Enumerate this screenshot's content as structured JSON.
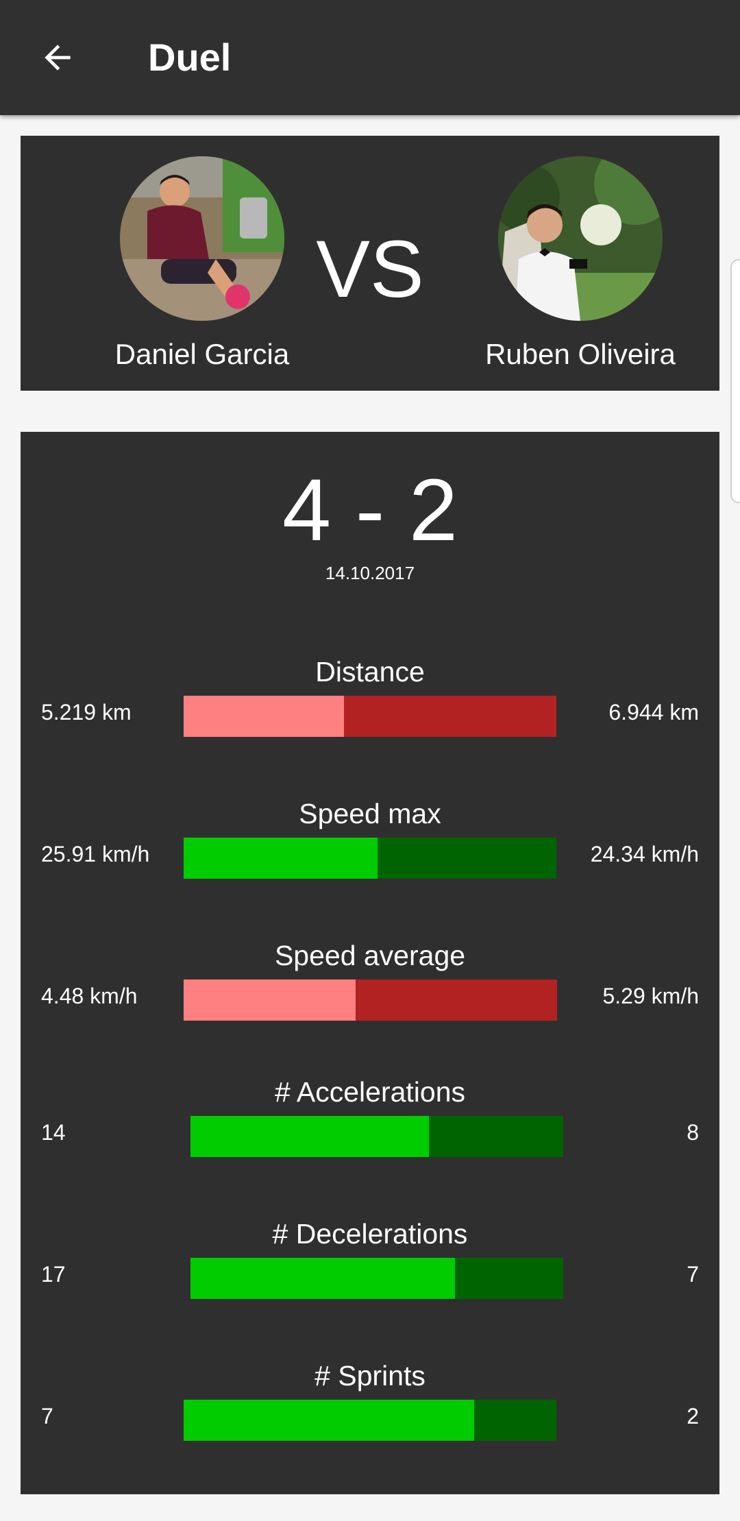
{
  "header": {
    "title": "Duel",
    "back_icon": "arrow-back-icon"
  },
  "duel": {
    "player_left": {
      "name": "Daniel Garcia"
    },
    "player_right": {
      "name": "Ruben Oliveira"
    },
    "vs_label": "VS",
    "score": "4 - 2",
    "date": "14.10.2017"
  },
  "colors": {
    "appbar": "#303030",
    "card": "#302f2f",
    "win_light": "#00cc00",
    "win_dark": "#006400",
    "lose_light": "#ff8080",
    "lose_dark": "#b22222"
  },
  "stats": [
    {
      "label": "Distance",
      "left_value": "5.219 km",
      "right_value": "6.944 km",
      "left_share": 0.43,
      "scheme": "lose"
    },
    {
      "label": "Speed max",
      "left_value": "25.91 km/h",
      "right_value": "24.34 km/h",
      "left_share": 0.52,
      "scheme": "win"
    },
    {
      "label": "Speed average",
      "left_value": "4.48 km/h",
      "right_value": "5.29 km/h",
      "left_share": 0.46,
      "scheme": "lose"
    },
    {
      "label": "# Accelerations",
      "left_value": "14",
      "right_value": "8",
      "left_share": 0.64,
      "scheme": "win"
    },
    {
      "label": "# Decelerations",
      "left_value": "17",
      "right_value": "7",
      "left_share": 0.71,
      "scheme": "win"
    },
    {
      "label": "# Sprints",
      "left_value": "7",
      "right_value": "2",
      "left_share": 0.78,
      "scheme": "win"
    }
  ]
}
